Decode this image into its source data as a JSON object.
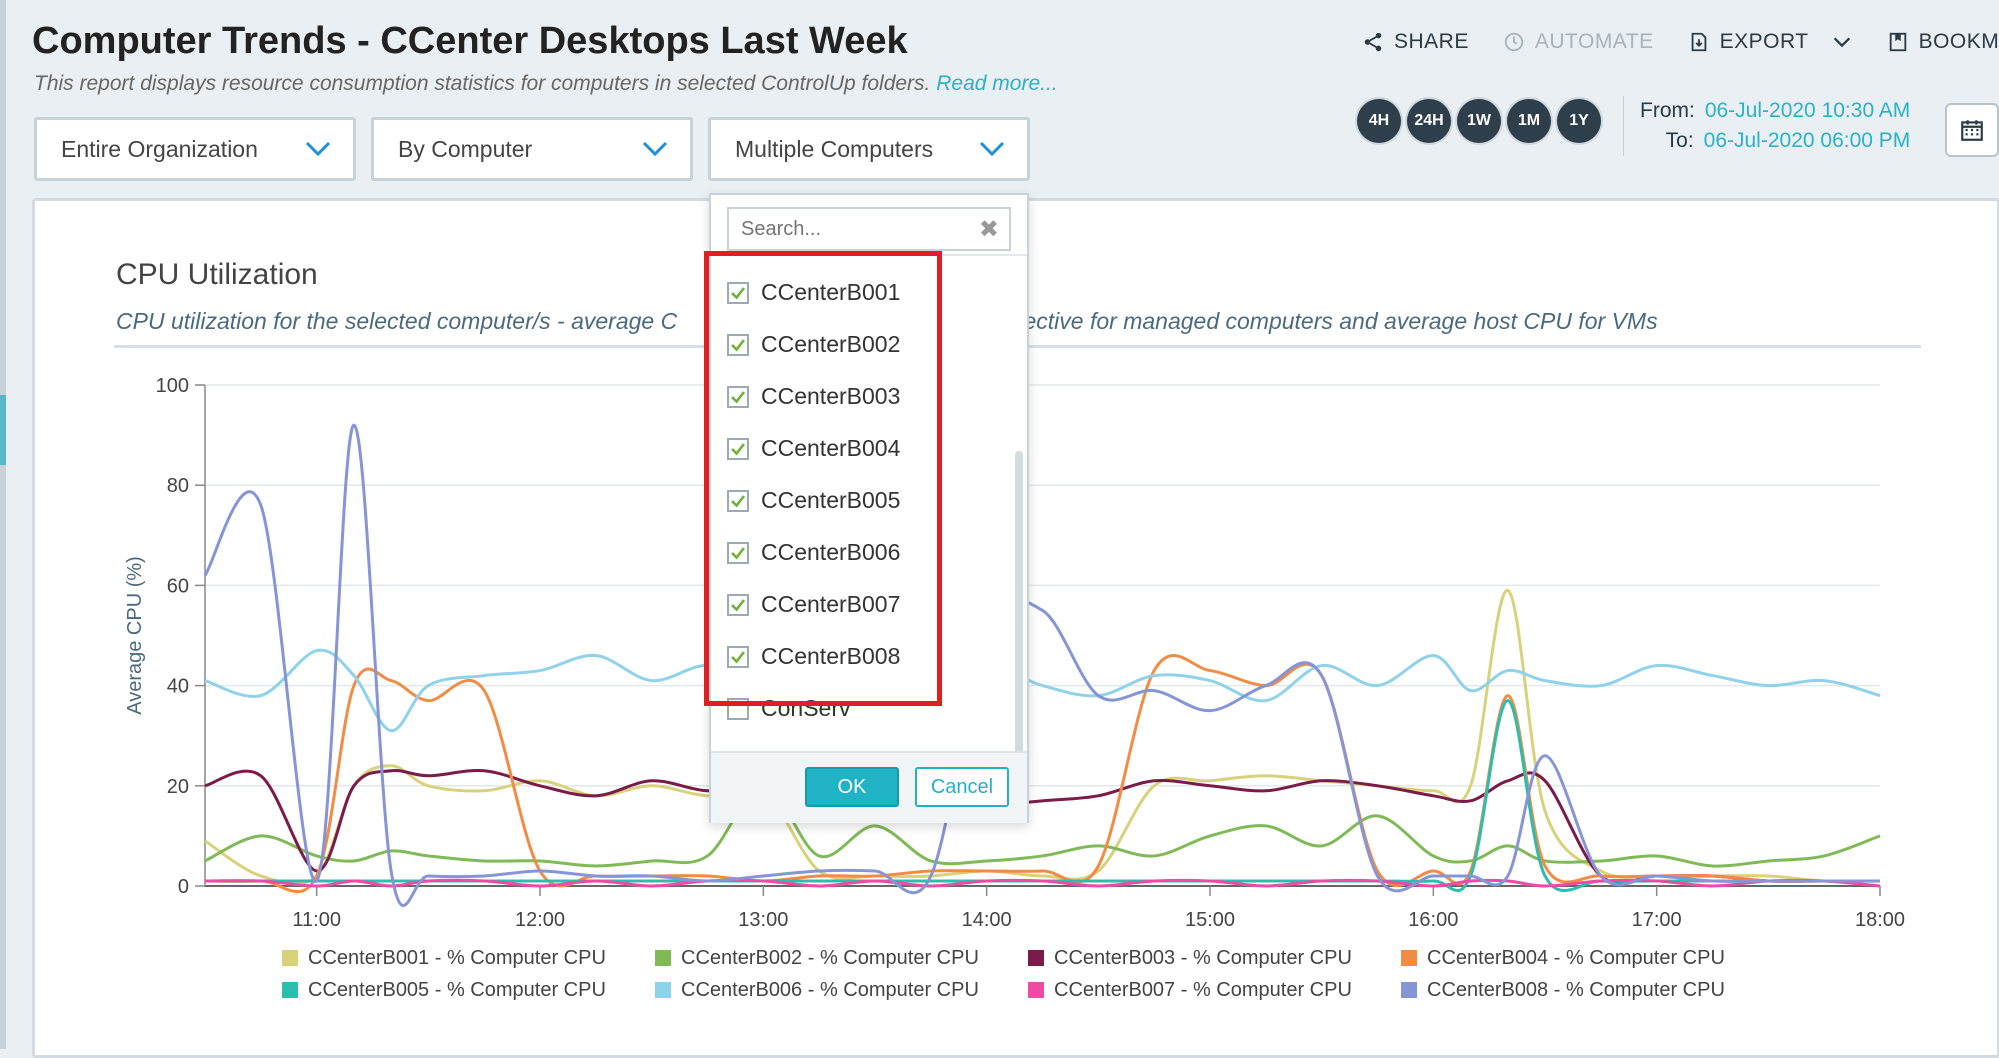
{
  "header": {
    "title": "Computer Trends - CCenter Desktops Last Week",
    "subtitle": "This report displays resource consumption statistics for computers in selected ControlUp folders.",
    "read_more": "Read more..."
  },
  "actions": {
    "share": "SHARE",
    "automate": "AUTOMATE",
    "export": "EXPORT",
    "bookmark": "BOOKMARK"
  },
  "time_range": {
    "buttons": [
      "4H",
      "24H",
      "1W",
      "1M",
      "1Y"
    ],
    "from_label": "From:",
    "from_value": "06-Jul-2020 10:30 AM",
    "to_label": "To:",
    "to_value": "06-Jul-2020 06:00 PM"
  },
  "filters": {
    "scope": "Entire Organization",
    "grouping": "By Computer",
    "computers": "Multiple Computers"
  },
  "popup": {
    "search_placeholder": "Search...",
    "items": [
      {
        "label": "CCenterB001",
        "checked": true
      },
      {
        "label": "CCenterB002",
        "checked": true
      },
      {
        "label": "CCenterB003",
        "checked": true
      },
      {
        "label": "CCenterB004",
        "checked": true
      },
      {
        "label": "CCenterB005",
        "checked": true
      },
      {
        "label": "CCenterB006",
        "checked": true
      },
      {
        "label": "CCenterB007",
        "checked": true
      },
      {
        "label": "CCenterB008",
        "checked": true
      },
      {
        "label": "ConServ",
        "checked": false
      }
    ],
    "ok_label": "OK",
    "cancel_label": "Cancel"
  },
  "chart": {
    "title": "CPU Utilization",
    "subtitle_left": "CPU utilization for the selected computer/s - average C",
    "subtitle_right": "spective for managed computers and average host CPU for VMs"
  },
  "chart_data": {
    "type": "line",
    "ylabel": "Average CPU (%)",
    "xlabel": "",
    "ylim": [
      0,
      100
    ],
    "yticks": [
      0,
      20,
      40,
      60,
      80,
      100
    ],
    "xticks": [
      "11:00",
      "12:00",
      "13:00",
      "14:00",
      "15:00",
      "16:00",
      "17:00",
      "18:00"
    ],
    "xlim": [
      "10:30",
      "18:00"
    ],
    "grid": true,
    "legend_position": "bottom",
    "x": [
      "10:30",
      "10:45",
      "11:00",
      "11:10",
      "11:20",
      "11:30",
      "11:45",
      "12:00",
      "12:15",
      "12:30",
      "12:45",
      "13:00",
      "13:15",
      "13:30",
      "13:45",
      "14:00",
      "14:15",
      "14:30",
      "14:45",
      "15:00",
      "15:15",
      "15:30",
      "15:45",
      "16:00",
      "16:10",
      "16:20",
      "16:30",
      "16:45",
      "17:00",
      "17:15",
      "17:30",
      "17:45",
      "18:00"
    ],
    "series": [
      {
        "name": "CCenterB001 - % Computer CPU",
        "color": "#d8d27a",
        "values": [
          9,
          2,
          2,
          20,
          24,
          20,
          19,
          21,
          18,
          20,
          18,
          19,
          3,
          2,
          2,
          3,
          2,
          3,
          20,
          21,
          22,
          21,
          20,
          19,
          20,
          59,
          15,
          3,
          2,
          2,
          2,
          1,
          1
        ]
      },
      {
        "name": "CCenterB002 - % Computer CPU",
        "color": "#7fba57",
        "values": [
          5,
          10,
          6,
          5,
          7,
          6,
          5,
          5,
          4,
          5,
          6,
          20,
          6,
          12,
          5,
          5,
          6,
          8,
          6,
          10,
          12,
          8,
          14,
          6,
          5,
          8,
          5,
          5,
          6,
          4,
          5,
          6,
          10
        ]
      },
      {
        "name": "CCenterB003 - % Computer CPU",
        "color": "#7a1b4a",
        "values": [
          20,
          22,
          3,
          20,
          23,
          22,
          23,
          20,
          18,
          21,
          19,
          20,
          21,
          18,
          15,
          16,
          17,
          18,
          21,
          20,
          19,
          21,
          20,
          18,
          17,
          21,
          21,
          2,
          2,
          2,
          1,
          1,
          1
        ]
      },
      {
        "name": "CCenterB004 - % Computer CPU",
        "color": "#f28c45",
        "values": [
          1,
          1,
          2,
          40,
          41,
          37,
          39,
          3,
          2,
          2,
          2,
          1,
          2,
          2,
          3,
          3,
          3,
          4,
          43,
          43,
          40,
          42,
          3,
          3,
          3,
          38,
          4,
          2,
          2,
          2,
          1,
          1,
          1
        ]
      },
      {
        "name": "CCenterB005 - % Computer CPU",
        "color": "#2dbdae",
        "values": [
          1,
          1,
          1,
          1,
          1,
          1,
          1,
          1,
          1,
          1,
          1,
          1,
          1,
          1,
          1,
          1,
          1,
          1,
          1,
          1,
          1,
          1,
          1,
          1,
          2,
          37,
          2,
          1,
          1,
          1,
          1,
          1,
          1
        ]
      },
      {
        "name": "CCenterB006 - % Computer CPU",
        "color": "#8fd2ea",
        "values": [
          41,
          38,
          47,
          42,
          31,
          40,
          42,
          43,
          46,
          41,
          44,
          40,
          43,
          41,
          39,
          44,
          40,
          38,
          42,
          41,
          37,
          44,
          40,
          46,
          39,
          43,
          41,
          40,
          44,
          42,
          40,
          41,
          38
        ]
      },
      {
        "name": "CCenterB007 - % Computer CPU",
        "color": "#ef4aa6",
        "values": [
          1,
          1,
          0,
          1,
          0,
          1,
          1,
          0,
          1,
          0,
          1,
          1,
          0,
          1,
          0,
          1,
          1,
          0,
          1,
          1,
          0,
          1,
          1,
          0,
          1,
          1,
          0,
          1,
          1,
          0,
          1,
          1,
          0
        ]
      },
      {
        "name": "CCenterB008 - % Computer CPU",
        "color": "#8595d6",
        "values": [
          62,
          76,
          1,
          92,
          3,
          2,
          2,
          3,
          2,
          2,
          1,
          2,
          3,
          3,
          2,
          51,
          55,
          38,
          39,
          35,
          40,
          42,
          2,
          2,
          2,
          2,
          26,
          2,
          2,
          1,
          1,
          1,
          1
        ]
      }
    ]
  }
}
